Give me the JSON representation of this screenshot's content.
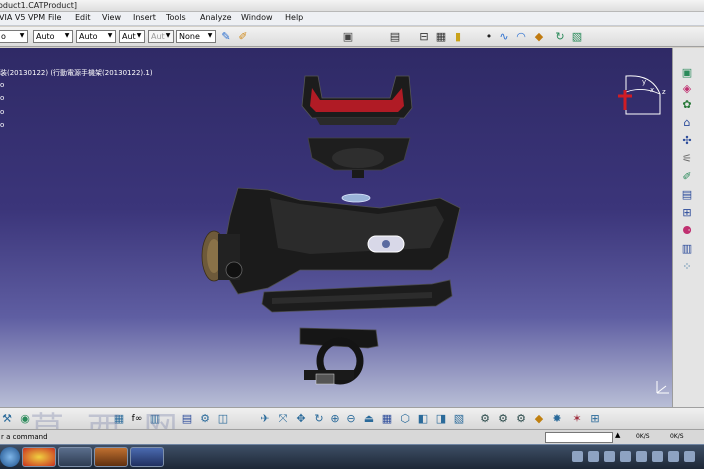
{
  "window": {
    "title": "oduct1.CATProduct]"
  },
  "menu": {
    "items": [
      "VIA V5 VPM",
      "File",
      "Edit",
      "View",
      "Insert",
      "Tools",
      "Analyze",
      "Window",
      "Help"
    ]
  },
  "toolbar": {
    "combos": [
      {
        "value": "o"
      },
      {
        "value": "Auto"
      },
      {
        "value": "Auto"
      },
      {
        "value": "Aut"
      },
      {
        "value": "Aut"
      },
      {
        "value": "None"
      }
    ]
  },
  "tree": {
    "root": "装(20130122) (行動電源手機架(20130122).1)",
    "nodes": [
      "o",
      "o",
      "o",
      "o"
    ]
  },
  "status": {
    "prompt": "r a command",
    "net_speed_1": "0K/S",
    "net_speed_2": "0K/S"
  },
  "watermark": {
    "text": "莫 西 网"
  },
  "compass": {
    "axis_x": "x",
    "axis_y": "y",
    "axis_z": "z"
  },
  "colors": {
    "viewport_top": "#2f2a66",
    "viewport_bottom": "#b8bed6",
    "accent_red": "#c8202a"
  },
  "icons": {
    "toolbar": [
      "camera-icon",
      "document-icon",
      "bracket-icon",
      "battery-icon",
      "dot-icon",
      "curve-icon",
      "surface-icon",
      "rotate-icon",
      "sheet-icon"
    ],
    "right": [
      "cube-icon",
      "cube-icon",
      "gear-icon",
      "frame-icon",
      "dimension-icon",
      "spring-icon",
      "pencil-icon",
      "table-icon",
      "link-icon",
      "pin-icon",
      "sheet-icon",
      "dots-icon"
    ],
    "bottom": [
      "wrench-icon",
      "eye-icon",
      "grid-icon",
      "fx-icon",
      "chart-icon",
      "doc-icon",
      "pan-icon",
      "rotate-icon",
      "zoom-in-icon",
      "zoom-out-icon",
      "fit-icon",
      "cube-view-icon",
      "render-icon",
      "layers-icon"
    ]
  }
}
